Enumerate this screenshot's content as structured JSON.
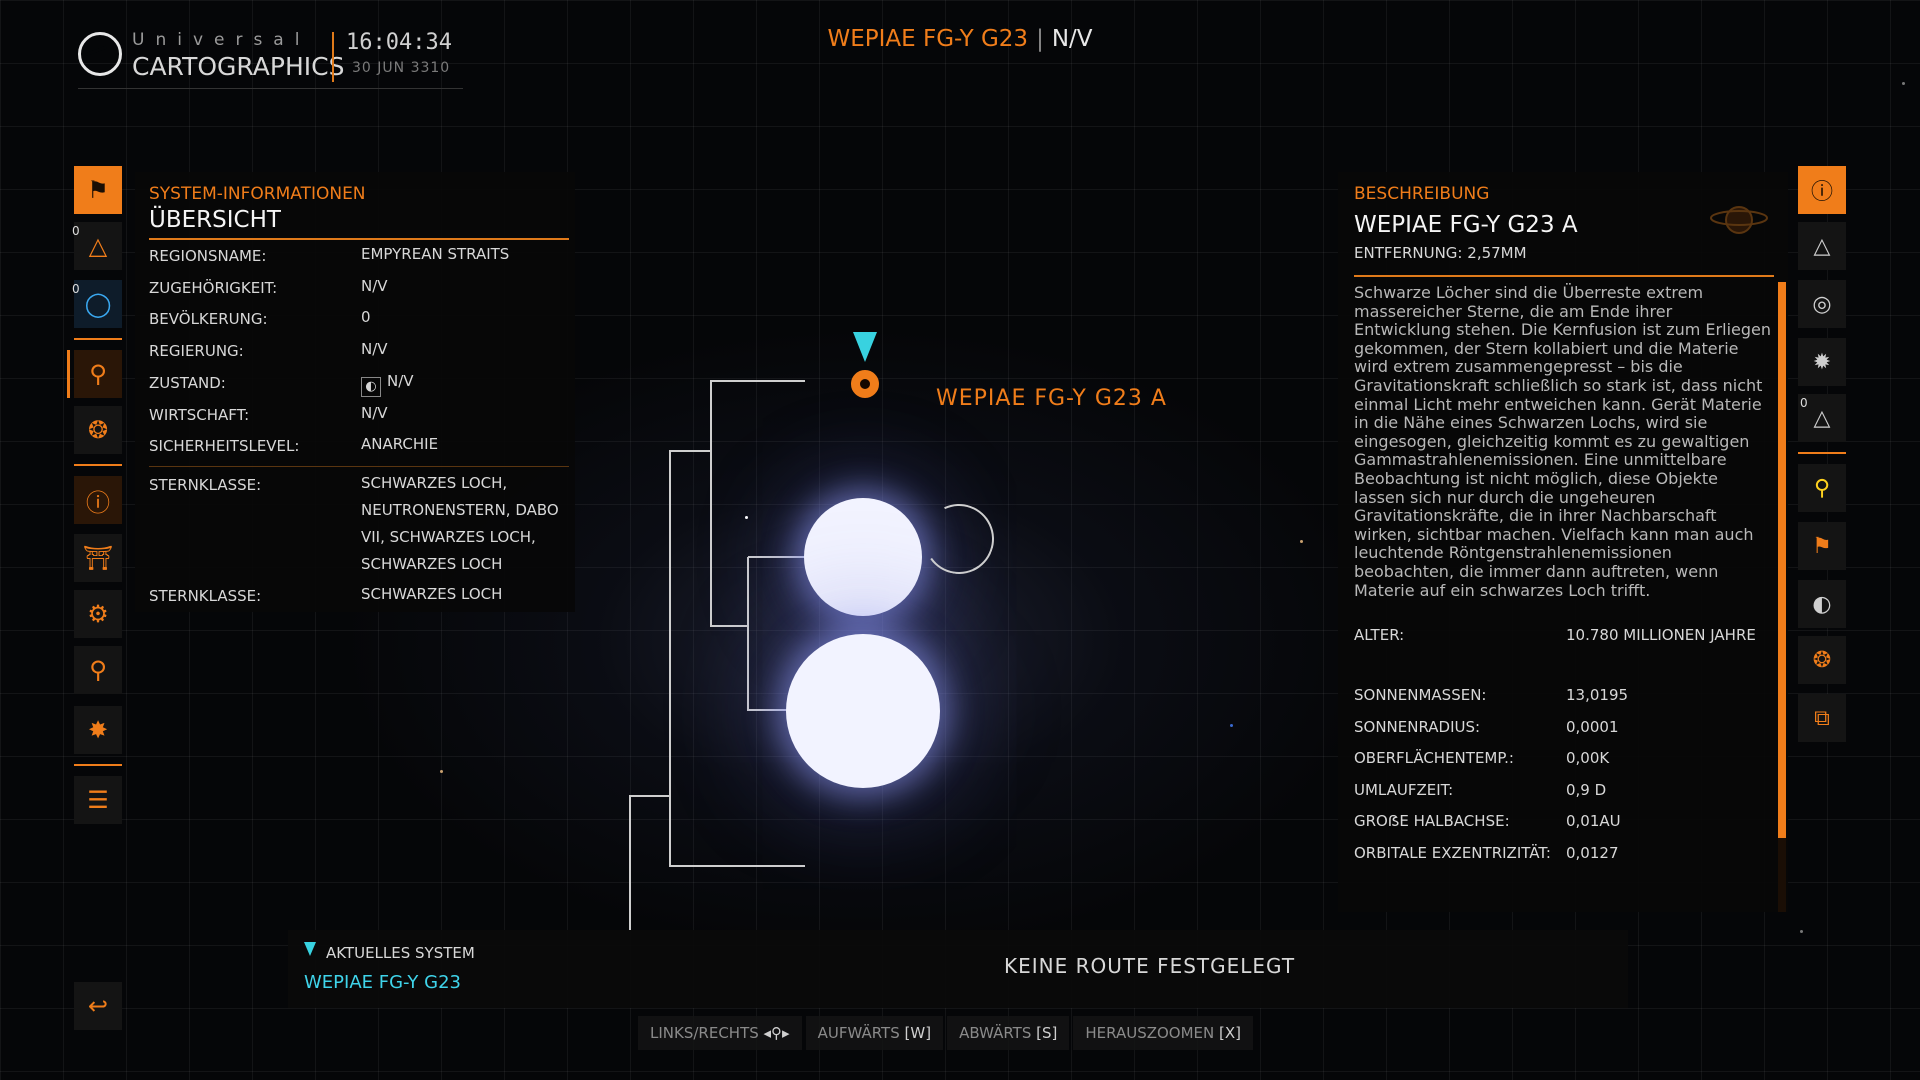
{
  "header": {
    "brand_top": "Universal",
    "brand_bottom": "CARTOGRAPHICS",
    "time": "16:04:34",
    "date": "30 JUN 3310",
    "system_title": "WEPIAE FG-Y G23",
    "separator": "|",
    "allegiance": "N/V"
  },
  "left_nav": {
    "items": [
      {
        "icon": "bookmark-icon"
      },
      {
        "icon": "planet-landing-icon",
        "count": "0"
      },
      {
        "icon": "globe-icon",
        "count": "0"
      },
      {
        "icon": "system-map-icon"
      },
      {
        "icon": "faction-icon"
      },
      {
        "icon": "info-icon"
      },
      {
        "icon": "station-icon"
      },
      {
        "icon": "settings-icon"
      },
      {
        "icon": "location-pin-icon"
      },
      {
        "icon": "powerplay-icon"
      },
      {
        "icon": "list-icon"
      },
      {
        "icon": "exit-icon"
      }
    ]
  },
  "system_info": {
    "category": "SYSTEM-INFORMATIONEN",
    "title": "ÜBERSICHT",
    "rows": [
      {
        "label": "REGIONSNAME:",
        "value": "EMPYREAN STRAITS"
      },
      {
        "label": "ZUGEHÖRIGKEIT:",
        "value": "N/V"
      },
      {
        "label": "BEVÖLKERUNG:",
        "value": "0"
      },
      {
        "label": "REGIERUNG:",
        "value": "N/V"
      },
      {
        "label": "ZUSTAND:",
        "value": "N/V"
      },
      {
        "label": "WIRTSCHAFT:",
        "value": "N/V"
      },
      {
        "label": "SICHERHEITSLEVEL:",
        "value": "ANARCHIE"
      },
      {
        "label": "STERNKLASSE:",
        "value": "SCHWARZES LOCH, NEUTRONENSTERN, DABO VII, SCHWARZES LOCH, SCHWARZES LOCH"
      },
      {
        "label": "STERNKLASSE:",
        "value": "SCHWARZES LOCH"
      }
    ]
  },
  "map": {
    "selected_body_label": "WEPIAE FG-Y G23 A"
  },
  "description": {
    "category": "BESCHREIBUNG",
    "title": "WEPIAE FG-Y G23 A",
    "distance_label": "ENTFERNUNG:",
    "distance_value": "2,57MM",
    "text": "Schwarze Löcher sind die Überreste extrem massereicher Sterne, die am Ende ihrer Entwicklung stehen. Die Kernfusion ist zum Erliegen gekommen, der Stern kollabiert und die Materie wird extrem zusammengepresst – bis die Gravitationskraft schließlich so stark ist, dass nicht einmal Licht mehr entweichen kann. Gerät Materie in die Nähe eines Schwarzen Lochs, wird sie eingesogen, gleichzeitig kommt es zu gewaltigen Gammastrahlenemissionen. Eine unmittelbare Beobachtung ist nicht möglich, diese Objekte lassen sich nur durch die ungeheuren Gravitationskräfte, die in ihrer Nachbarschaft wirken, sichtbar machen. Vielfach kann man auch leuchtende Röntgenstrahlenemissionen beobachten, die immer dann auftreten, wenn Materie auf ein schwarzes Loch trifft.",
    "rows": [
      {
        "label": "ALTER:",
        "value": "10.780 MILLIONEN JAHRE"
      },
      {
        "label": "SONNENMASSEN:",
        "value": "13,0195"
      },
      {
        "label": "SONNENRADIUS:",
        "value": "0,0001"
      },
      {
        "label": "OBERFLÄCHENTEMP.:",
        "value": "0,00K"
      },
      {
        "label": "UMLAUFZEIT:",
        "value": "0,9 D"
      },
      {
        "label": "GROẞE HALBACHSE:",
        "value": "0,01AU"
      },
      {
        "label": "ORBITALE EXZENTRIZITÄT:",
        "value": "0,0127"
      }
    ]
  },
  "right_nav": {
    "items": [
      {
        "icon": "info-scan-icon"
      },
      {
        "icon": "landable-icon"
      },
      {
        "icon": "orbit-icon"
      },
      {
        "icon": "ring-icon"
      },
      {
        "icon": "planet-landing-icon",
        "count": "0"
      },
      {
        "icon": "yellow-pin-icon"
      },
      {
        "icon": "bookmark-add-icon"
      },
      {
        "icon": "moon-icon"
      },
      {
        "icon": "cluster-icon"
      },
      {
        "icon": "copy-icon"
      }
    ]
  },
  "bottom_bar": {
    "current_label": "AKTUELLES SYSTEM",
    "current_system": "WEPIAE FG-Y G23",
    "route_status": "KEINE ROUTE FESTGELEGT"
  },
  "controls": [
    {
      "label": "LINKS/RECHTS",
      "key": "◂⚲▸"
    },
    {
      "label": "AUFWÄRTS",
      "key": "[W]"
    },
    {
      "label": "ABWÄRTS",
      "key": "[S]"
    },
    {
      "label": "HERAUSZOOMEN",
      "key": "[X]"
    }
  ],
  "colors": {
    "accent": "#f07d1a",
    "cyan": "#38d2e0",
    "background": "#050608"
  }
}
